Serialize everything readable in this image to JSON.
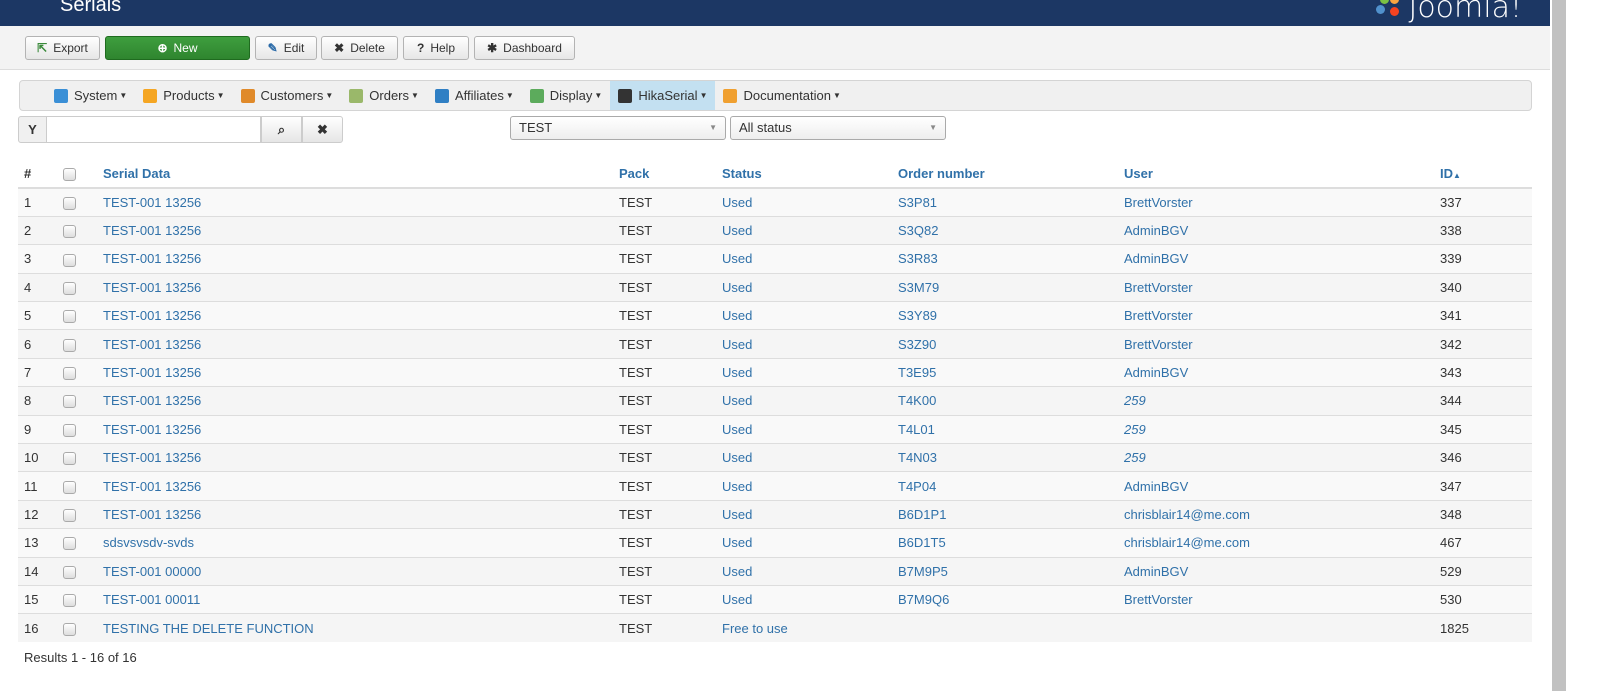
{
  "header": {
    "title": "Serials",
    "logo": "Joomla!"
  },
  "toolbar": {
    "export": "Export",
    "new": "New",
    "edit": "Edit",
    "delete": "Delete",
    "help": "Help",
    "dashboard": "Dashboard"
  },
  "menu": [
    {
      "label": "System",
      "icon": "tools-icon",
      "color": "#3a8fd6"
    },
    {
      "label": "Products",
      "icon": "box-icon",
      "color": "#f5a623"
    },
    {
      "label": "Customers",
      "icon": "users-icon",
      "color": "#e08a2a"
    },
    {
      "label": "Orders",
      "icon": "orders-icon",
      "color": "#9ab86a"
    },
    {
      "label": "Affiliates",
      "icon": "affiliates-icon",
      "color": "#2f7fc4"
    },
    {
      "label": "Display",
      "icon": "display-icon",
      "color": "#5cab5c"
    },
    {
      "label": "HikaSerial",
      "icon": "serial-icon",
      "color": "#333333"
    },
    {
      "label": "Documentation",
      "icon": "lifebuoy-icon",
      "color": "#f0a030"
    }
  ],
  "filter": {
    "search_value": "",
    "pack_select": "TEST",
    "status_select": "All status"
  },
  "table": {
    "headers": {
      "num": "#",
      "serial": "Serial Data",
      "pack": "Pack",
      "status": "Status",
      "order": "Order number",
      "user": "User",
      "id": "ID"
    },
    "rows": [
      [
        "1",
        "TEST-001 13256",
        "TEST",
        "Used",
        "S3P81",
        "BrettVorster",
        "337"
      ],
      [
        "2",
        "TEST-001 13256",
        "TEST",
        "Used",
        "S3Q82",
        "AdminBGV",
        "338"
      ],
      [
        "3",
        "TEST-001 13256",
        "TEST",
        "Used",
        "S3R83",
        "AdminBGV",
        "339"
      ],
      [
        "4",
        "TEST-001 13256",
        "TEST",
        "Used",
        "S3M79",
        "BrettVorster",
        "340"
      ],
      [
        "5",
        "TEST-001 13256",
        "TEST",
        "Used",
        "S3Y89",
        "BrettVorster",
        "341"
      ],
      [
        "6",
        "TEST-001 13256",
        "TEST",
        "Used",
        "S3Z90",
        "BrettVorster",
        "342"
      ],
      [
        "7",
        "TEST-001 13256",
        "TEST",
        "Used",
        "T3E95",
        "AdminBGV",
        "343"
      ],
      [
        "8",
        "TEST-001 13256",
        "TEST",
        "Used",
        "T4K00",
        "259",
        "344"
      ],
      [
        "9",
        "TEST-001 13256",
        "TEST",
        "Used",
        "T4L01",
        "259",
        "345"
      ],
      [
        "10",
        "TEST-001 13256",
        "TEST",
        "Used",
        "T4N03",
        "259",
        "346"
      ],
      [
        "11",
        "TEST-001 13256",
        "TEST",
        "Used",
        "T4P04",
        "AdminBGV",
        "347"
      ],
      [
        "12",
        "TEST-001 13256",
        "TEST",
        "Used",
        "B6D1P1",
        "chrisblair14@me.com",
        "348"
      ],
      [
        "13",
        "sdsvsvsdv-svds",
        "TEST",
        "Used",
        "B6D1T5",
        "chrisblair14@me.com",
        "467"
      ],
      [
        "14",
        "TEST-001 00000",
        "TEST",
        "Used",
        "B7M9P5",
        "AdminBGV",
        "529"
      ],
      [
        "15",
        "TEST-001 00011",
        "TEST",
        "Used",
        "B7M9Q6",
        "BrettVorster",
        "530"
      ],
      [
        "16",
        "TESTING THE DELETE FUNCTION",
        "TEST",
        "Free to use",
        "",
        "",
        "1825"
      ]
    ]
  },
  "footer": {
    "results": "Results 1 - 16 of 16"
  }
}
